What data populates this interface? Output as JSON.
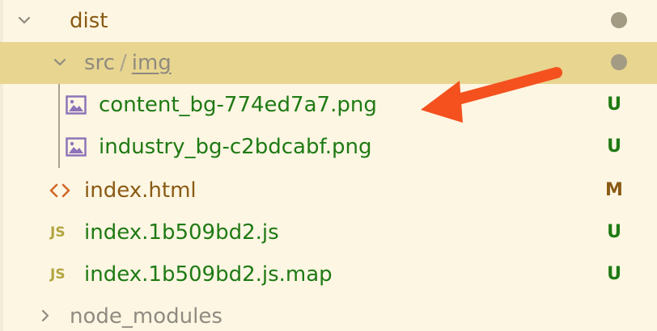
{
  "explorer": {
    "rows": [
      {
        "name": "dist",
        "type": "folder",
        "expanded": true,
        "git_status": "dot"
      },
      {
        "name_parts": [
          "src",
          "/",
          "img"
        ],
        "type": "folder",
        "expanded": true,
        "selected": true,
        "git_status": "dot"
      },
      {
        "name": "content_bg-774ed7a7.png",
        "type": "image",
        "git_status": "U",
        "icon": "image-icon"
      },
      {
        "name": "industry_bg-c2bdcabf.png",
        "type": "image",
        "git_status": "U",
        "icon": "image-icon"
      },
      {
        "name": "index.html",
        "type": "html",
        "git_status": "M",
        "icon": "html-code-icon"
      },
      {
        "name": "index.1b509bd2.js",
        "type": "js",
        "git_status": "U",
        "icon": "js-icon",
        "icon_text": "JS"
      },
      {
        "name": "index.1b509bd2.js.map",
        "type": "js",
        "git_status": "U",
        "icon": "js-icon",
        "icon_text": "JS"
      },
      {
        "name": "node_modules",
        "type": "folder",
        "expanded": false
      }
    ]
  },
  "colors": {
    "background": "#fdf6e3",
    "selected_row": "#e8d590",
    "folder_text": "#8a5a14",
    "untracked_text": "#1f7a14",
    "modified_text": "#8a5a14",
    "muted_text": "#8f8b80",
    "annotation_arrow": "#f4511e",
    "image_icon": "#8e74b8",
    "js_icon": "#b3a53f"
  }
}
